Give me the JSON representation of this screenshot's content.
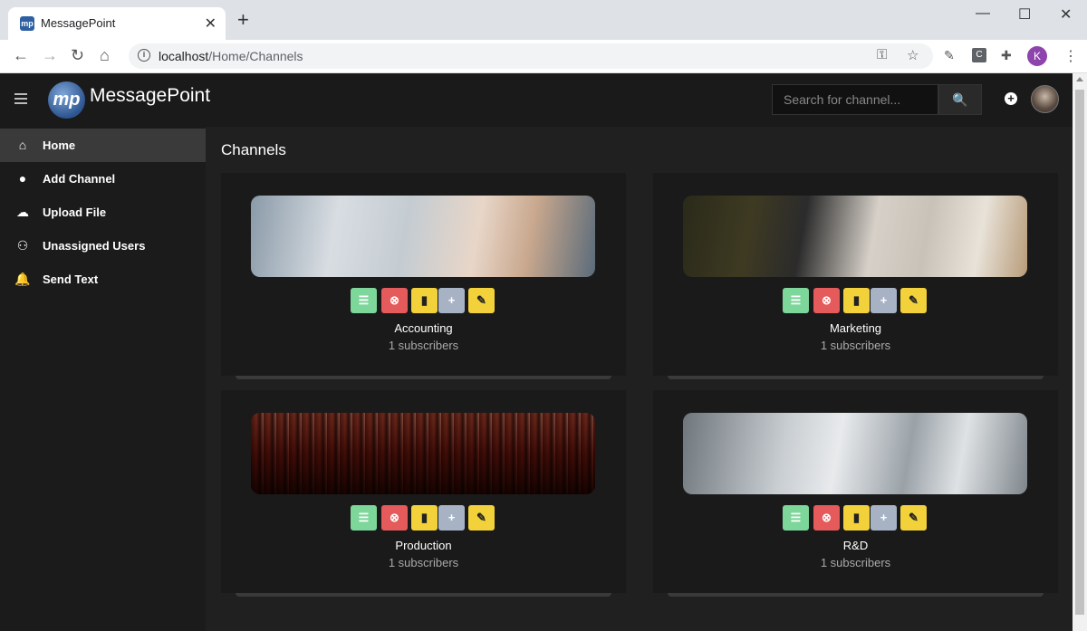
{
  "browser": {
    "tab_title": "MessagePoint",
    "favicon_text": "mp",
    "url_host": "localhost",
    "url_path": "/Home/Channels",
    "profile_initial": "K",
    "ext_c": "C"
  },
  "app": {
    "logo_text": "mp",
    "title": "MessagePoint",
    "search_placeholder": "Search for channel..."
  },
  "sidebar": {
    "items": [
      {
        "label": "Home",
        "icon": "home-icon",
        "active": true
      },
      {
        "label": "Add Channel",
        "icon": "user-icon"
      },
      {
        "label": "Upload File",
        "icon": "cloud-upload-icon"
      },
      {
        "label": "Unassigned Users",
        "icon": "users-icon"
      },
      {
        "label": "Send Text",
        "icon": "bell-icon"
      }
    ]
  },
  "main": {
    "title": "Channels",
    "channels": [
      {
        "name": "Accounting",
        "subscribers": "1 subscribers"
      },
      {
        "name": "Marketing",
        "subscribers": "1 subscribers"
      },
      {
        "name": "Production",
        "subscribers": "1 subscribers"
      },
      {
        "name": "R&D",
        "subscribers": "1 subscribers"
      }
    ]
  },
  "colors": {
    "list_button": "#7dd69a",
    "delete_button": "#e55a5a",
    "file_button": "#f2d13b",
    "add_button": "#a7b3c4",
    "edit_button": "#f2d13b"
  }
}
